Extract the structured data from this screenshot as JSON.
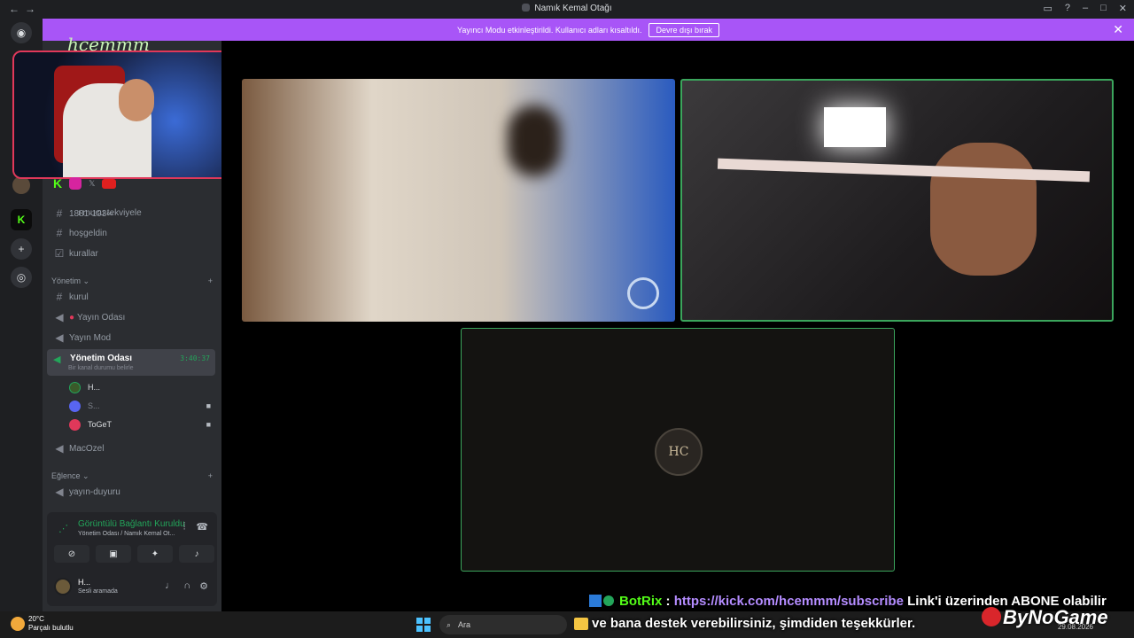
{
  "window": {
    "title": "Namık Kemal Otağı"
  },
  "banner": {
    "text": "Yayıncı Modu etkinleştirildi. Kullanıcı adları kısaltıldı.",
    "button": "Devre dışı bırak"
  },
  "sidebar": {
    "partial_channel": "ı mucu tekviyele",
    "channels_top": [
      "1881-193∞",
      "hoşgeldin",
      "kurallar"
    ],
    "categories": {
      "yonetim": "Yönetim",
      "eglence": "Eğlence"
    },
    "yonetim_channels": [
      "kurul",
      "Yayın Odası",
      "Yayın Mod",
      "MacOzel"
    ],
    "active_channel": {
      "name": "Yönetim Odası",
      "timer": "3:40:37",
      "status": "Bir kanal durumu belirle"
    },
    "voice_users": [
      {
        "name": "H..."
      },
      {
        "name": "S..."
      },
      {
        "name": "ToGeT"
      }
    ],
    "eglence_channels": [
      "yayın-duyuru"
    ]
  },
  "voice_panel": {
    "status": "Görüntülü Bağlantı Kuruldu",
    "channel": "Yönetim Odası",
    "server": "/ Namık Kemal Ot...",
    "user_name": "H...",
    "user_status": "Sesli aramada"
  },
  "overlay": {
    "bot_name": "BotRix",
    "separator": ":",
    "url": "https://kick.com/hcemmm/subscribe",
    "line1_rest": "Link'i üzerinden ABONE olabilir",
    "line2": "ve bana destek verebilirsiniz, şimdiden teşekkürler.",
    "brand": "ByNoGame",
    "webcam_logo": "hcemmm"
  },
  "tile3": {
    "avatar_text": "HC"
  },
  "taskbar": {
    "temperature": "20°C",
    "weather": "Parçalı bulutlu",
    "search": "Ara",
    "date": "29.08.2026"
  }
}
